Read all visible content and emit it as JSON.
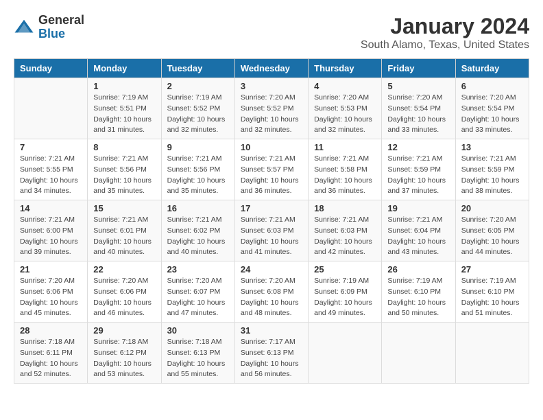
{
  "app": {
    "name_general": "General",
    "name_blue": "Blue"
  },
  "title": "January 2024",
  "subtitle": "South Alamo, Texas, United States",
  "days_of_week": [
    "Sunday",
    "Monday",
    "Tuesday",
    "Wednesday",
    "Thursday",
    "Friday",
    "Saturday"
  ],
  "weeks": [
    [
      {
        "day": "",
        "sunrise": "",
        "sunset": "",
        "daylight": ""
      },
      {
        "day": "1",
        "sunrise": "Sunrise: 7:19 AM",
        "sunset": "Sunset: 5:51 PM",
        "daylight": "Daylight: 10 hours and 31 minutes."
      },
      {
        "day": "2",
        "sunrise": "Sunrise: 7:19 AM",
        "sunset": "Sunset: 5:52 PM",
        "daylight": "Daylight: 10 hours and 32 minutes."
      },
      {
        "day": "3",
        "sunrise": "Sunrise: 7:20 AM",
        "sunset": "Sunset: 5:52 PM",
        "daylight": "Daylight: 10 hours and 32 minutes."
      },
      {
        "day": "4",
        "sunrise": "Sunrise: 7:20 AM",
        "sunset": "Sunset: 5:53 PM",
        "daylight": "Daylight: 10 hours and 32 minutes."
      },
      {
        "day": "5",
        "sunrise": "Sunrise: 7:20 AM",
        "sunset": "Sunset: 5:54 PM",
        "daylight": "Daylight: 10 hours and 33 minutes."
      },
      {
        "day": "6",
        "sunrise": "Sunrise: 7:20 AM",
        "sunset": "Sunset: 5:54 PM",
        "daylight": "Daylight: 10 hours and 33 minutes."
      }
    ],
    [
      {
        "day": "7",
        "sunrise": "Sunrise: 7:21 AM",
        "sunset": "Sunset: 5:55 PM",
        "daylight": "Daylight: 10 hours and 34 minutes."
      },
      {
        "day": "8",
        "sunrise": "Sunrise: 7:21 AM",
        "sunset": "Sunset: 5:56 PM",
        "daylight": "Daylight: 10 hours and 35 minutes."
      },
      {
        "day": "9",
        "sunrise": "Sunrise: 7:21 AM",
        "sunset": "Sunset: 5:56 PM",
        "daylight": "Daylight: 10 hours and 35 minutes."
      },
      {
        "day": "10",
        "sunrise": "Sunrise: 7:21 AM",
        "sunset": "Sunset: 5:57 PM",
        "daylight": "Daylight: 10 hours and 36 minutes."
      },
      {
        "day": "11",
        "sunrise": "Sunrise: 7:21 AM",
        "sunset": "Sunset: 5:58 PM",
        "daylight": "Daylight: 10 hours and 36 minutes."
      },
      {
        "day": "12",
        "sunrise": "Sunrise: 7:21 AM",
        "sunset": "Sunset: 5:59 PM",
        "daylight": "Daylight: 10 hours and 37 minutes."
      },
      {
        "day": "13",
        "sunrise": "Sunrise: 7:21 AM",
        "sunset": "Sunset: 5:59 PM",
        "daylight": "Daylight: 10 hours and 38 minutes."
      }
    ],
    [
      {
        "day": "14",
        "sunrise": "Sunrise: 7:21 AM",
        "sunset": "Sunset: 6:00 PM",
        "daylight": "Daylight: 10 hours and 39 minutes."
      },
      {
        "day": "15",
        "sunrise": "Sunrise: 7:21 AM",
        "sunset": "Sunset: 6:01 PM",
        "daylight": "Daylight: 10 hours and 40 minutes."
      },
      {
        "day": "16",
        "sunrise": "Sunrise: 7:21 AM",
        "sunset": "Sunset: 6:02 PM",
        "daylight": "Daylight: 10 hours and 40 minutes."
      },
      {
        "day": "17",
        "sunrise": "Sunrise: 7:21 AM",
        "sunset": "Sunset: 6:03 PM",
        "daylight": "Daylight: 10 hours and 41 minutes."
      },
      {
        "day": "18",
        "sunrise": "Sunrise: 7:21 AM",
        "sunset": "Sunset: 6:03 PM",
        "daylight": "Daylight: 10 hours and 42 minutes."
      },
      {
        "day": "19",
        "sunrise": "Sunrise: 7:21 AM",
        "sunset": "Sunset: 6:04 PM",
        "daylight": "Daylight: 10 hours and 43 minutes."
      },
      {
        "day": "20",
        "sunrise": "Sunrise: 7:20 AM",
        "sunset": "Sunset: 6:05 PM",
        "daylight": "Daylight: 10 hours and 44 minutes."
      }
    ],
    [
      {
        "day": "21",
        "sunrise": "Sunrise: 7:20 AM",
        "sunset": "Sunset: 6:06 PM",
        "daylight": "Daylight: 10 hours and 45 minutes."
      },
      {
        "day": "22",
        "sunrise": "Sunrise: 7:20 AM",
        "sunset": "Sunset: 6:06 PM",
        "daylight": "Daylight: 10 hours and 46 minutes."
      },
      {
        "day": "23",
        "sunrise": "Sunrise: 7:20 AM",
        "sunset": "Sunset: 6:07 PM",
        "daylight": "Daylight: 10 hours and 47 minutes."
      },
      {
        "day": "24",
        "sunrise": "Sunrise: 7:20 AM",
        "sunset": "Sunset: 6:08 PM",
        "daylight": "Daylight: 10 hours and 48 minutes."
      },
      {
        "day": "25",
        "sunrise": "Sunrise: 7:19 AM",
        "sunset": "Sunset: 6:09 PM",
        "daylight": "Daylight: 10 hours and 49 minutes."
      },
      {
        "day": "26",
        "sunrise": "Sunrise: 7:19 AM",
        "sunset": "Sunset: 6:10 PM",
        "daylight": "Daylight: 10 hours and 50 minutes."
      },
      {
        "day": "27",
        "sunrise": "Sunrise: 7:19 AM",
        "sunset": "Sunset: 6:10 PM",
        "daylight": "Daylight: 10 hours and 51 minutes."
      }
    ],
    [
      {
        "day": "28",
        "sunrise": "Sunrise: 7:18 AM",
        "sunset": "Sunset: 6:11 PM",
        "daylight": "Daylight: 10 hours and 52 minutes."
      },
      {
        "day": "29",
        "sunrise": "Sunrise: 7:18 AM",
        "sunset": "Sunset: 6:12 PM",
        "daylight": "Daylight: 10 hours and 53 minutes."
      },
      {
        "day": "30",
        "sunrise": "Sunrise: 7:18 AM",
        "sunset": "Sunset: 6:13 PM",
        "daylight": "Daylight: 10 hours and 55 minutes."
      },
      {
        "day": "31",
        "sunrise": "Sunrise: 7:17 AM",
        "sunset": "Sunset: 6:13 PM",
        "daylight": "Daylight: 10 hours and 56 minutes."
      },
      {
        "day": "",
        "sunrise": "",
        "sunset": "",
        "daylight": ""
      },
      {
        "day": "",
        "sunrise": "",
        "sunset": "",
        "daylight": ""
      },
      {
        "day": "",
        "sunrise": "",
        "sunset": "",
        "daylight": ""
      }
    ]
  ]
}
